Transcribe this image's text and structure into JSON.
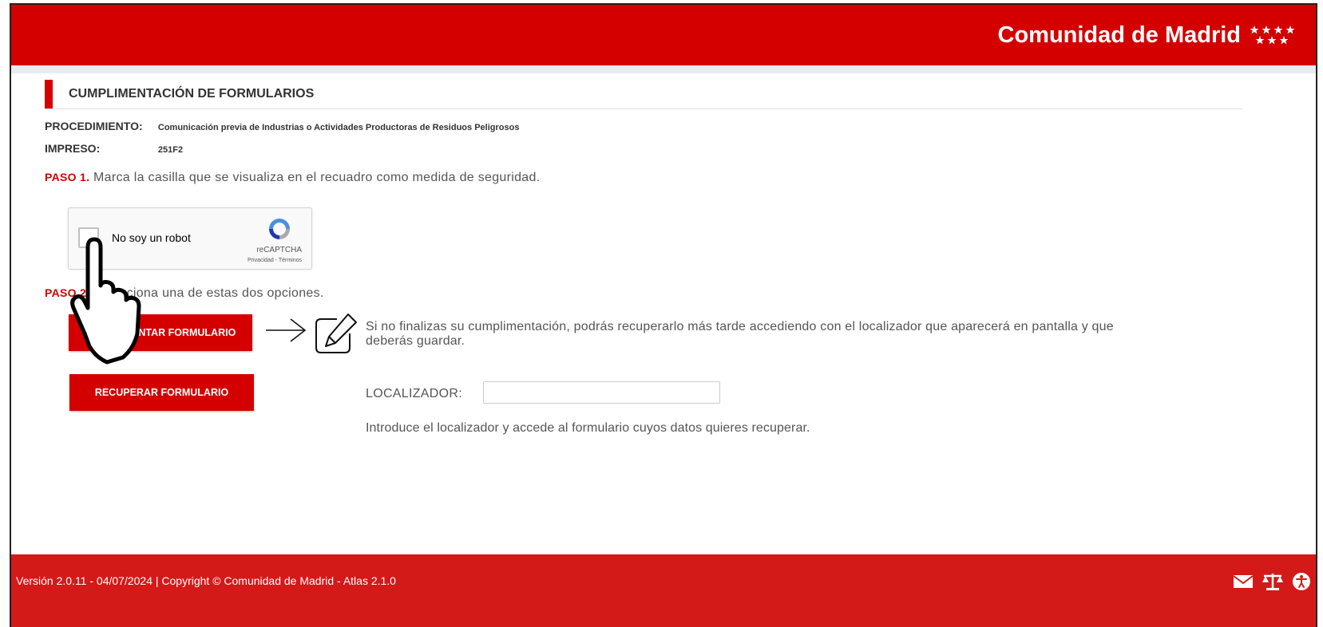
{
  "header": {
    "brand": "Comunidad de Madrid"
  },
  "section": {
    "title": "CUMPLIMENTACIÓN DE FORMULARIOS"
  },
  "meta": {
    "procedimiento_label": "PROCEDIMIENTO:",
    "procedimiento_value": "Comunicación previa de Industrias o Actividades Productoras de Residuos Peligrosos",
    "impreso_label": "IMPRESO:",
    "impreso_value": "251F2"
  },
  "step1": {
    "num": "PASO 1.",
    "text": " Marca la casilla que se visualiza en el recuadro como medida de seguridad."
  },
  "captcha": {
    "label": "No soy un robot",
    "brand": "reCAPTCHA",
    "terms": "Privacidad - Términos"
  },
  "step2": {
    "num": "PASO 2.",
    "text": " Selecciona una de estas dos opciones."
  },
  "buttons": {
    "fill": "CUMPLIMENTAR FORMULARIO",
    "recover": "RECUPERAR FORMULARIO"
  },
  "info": {
    "text": "Si no finalizas su cumplimentación, podrás recuperarlo más tarde accediendo con el localizador que aparecerá en pantalla y que deberás guardar."
  },
  "localizador": {
    "label": "LOCALIZADOR:",
    "value": "",
    "help": "Introduce el localizador y accede al formulario cuyos datos quieres recuperar."
  },
  "footer": {
    "text": "Versión 2.0.11 - 04/07/2024 | Copyright © Comunidad de Madrid - Atlas 2.1.0"
  },
  "colors": {
    "brand_red": "#d40000",
    "footer_red": "#d41919"
  },
  "icons": [
    "stars-logo-icon",
    "recaptcha-logo-icon",
    "arrow-right-icon",
    "edit-icon",
    "pointing-hand-icon",
    "mail-icon",
    "scales-icon",
    "accessibility-icon"
  ]
}
